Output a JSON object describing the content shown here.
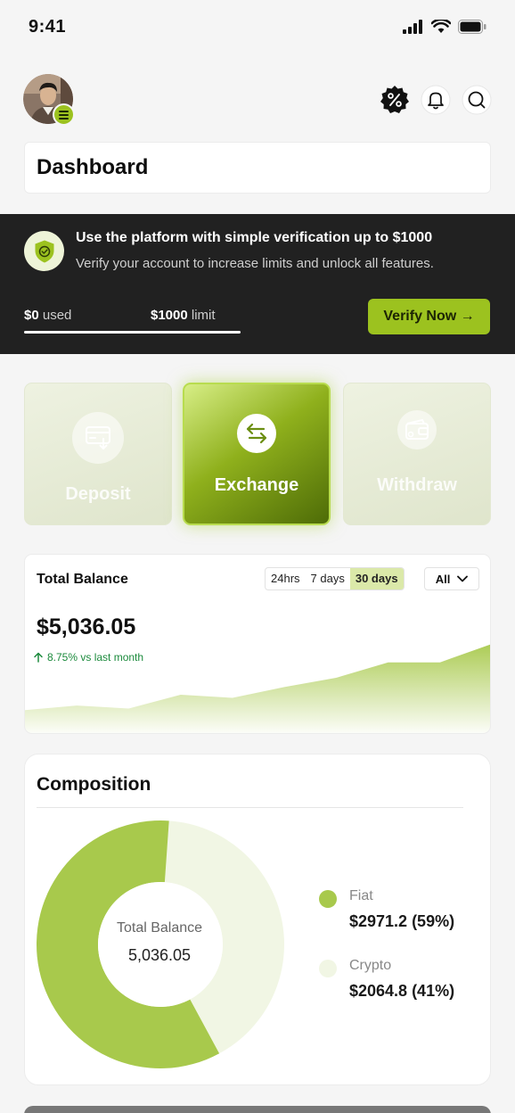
{
  "status_bar": {
    "time": "9:41"
  },
  "header": {
    "title": "Dashboard",
    "icons": [
      "discount-icon",
      "bell-icon",
      "search-icon"
    ]
  },
  "verification": {
    "title": "Use the platform with simple verification up to $1000",
    "subtitle": "Verify your account to increase limits and unlock all features.",
    "used_amount": "$0",
    "used_label": "used",
    "limit_amount": "$1000",
    "limit_label": "limit",
    "used_fraction": 0,
    "button_label": "Verify Now →"
  },
  "actions": [
    {
      "label": "Deposit",
      "icon": "deposit-card-icon",
      "active": false
    },
    {
      "label": "Exchange",
      "icon": "exchange-arrows-icon",
      "active": true
    },
    {
      "label": "Withdraw",
      "icon": "wallet-icon",
      "active": false
    }
  ],
  "balance": {
    "title": "Total Balance",
    "ranges": [
      "24hrs",
      "7 days",
      "30 days"
    ],
    "selected_range": "30 days",
    "filter_label": "All",
    "value": "$5,036.05",
    "change": "8.75% vs last month"
  },
  "composition": {
    "title": "Composition",
    "center_label": "Total Balance",
    "center_value": "5,036.05",
    "legend": [
      {
        "name": "Fiat",
        "value": "$2971.2 (59%)",
        "color": "#a8c94c"
      },
      {
        "name": "Crypto",
        "value": "$2064.8 (41%)",
        "color": "#f1f6e4"
      }
    ]
  },
  "chart_data": [
    {
      "type": "area",
      "title": "Total Balance",
      "x": [
        1,
        2,
        3,
        4,
        5,
        6,
        7,
        8,
        9,
        10
      ],
      "values": [
        1,
        4,
        2,
        11,
        9,
        16,
        22,
        32,
        32,
        44
      ],
      "color": "#a8c94c"
    },
    {
      "type": "pie",
      "title": "Composition",
      "categories": [
        "Fiat",
        "Crypto"
      ],
      "values": [
        2971.2,
        2064.8
      ],
      "colors": [
        "#a8c94c",
        "#f1f6e4"
      ]
    }
  ]
}
